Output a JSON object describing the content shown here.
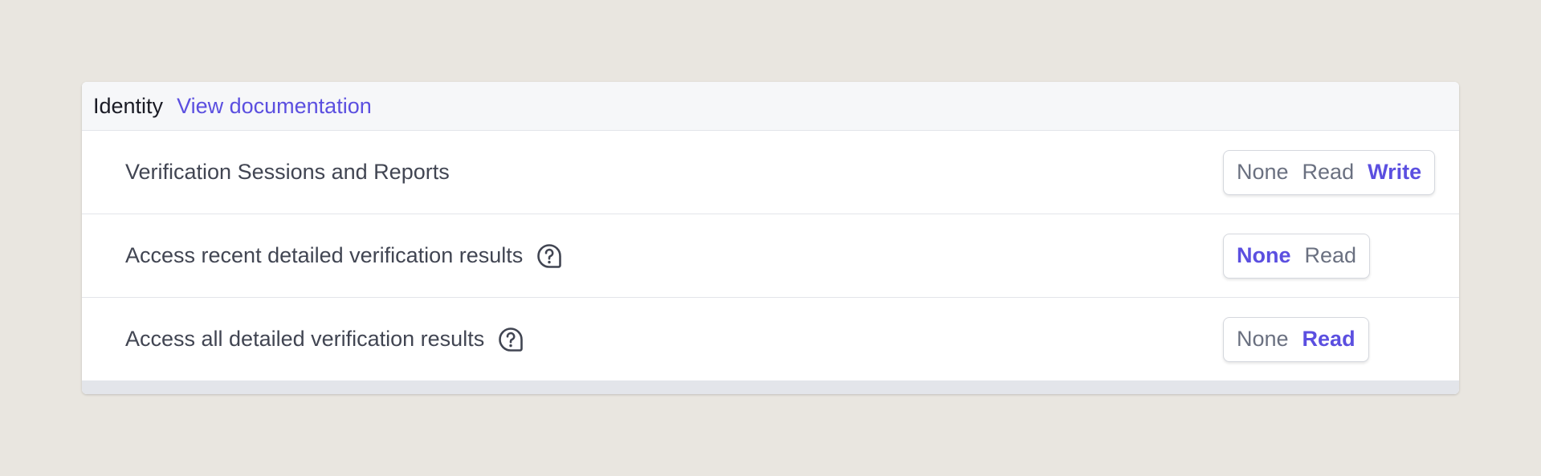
{
  "section": {
    "title": "Identity",
    "doc_link": "View documentation"
  },
  "rows": [
    {
      "label": "Verification Sessions and Reports",
      "has_help": false,
      "options": [
        "None",
        "Read",
        "Write"
      ],
      "selected": "Write"
    },
    {
      "label": "Access recent detailed verification results",
      "has_help": true,
      "options": [
        "None",
        "Read"
      ],
      "selected": "None"
    },
    {
      "label": "Access all detailed verification results",
      "has_help": true,
      "options": [
        "None",
        "Read"
      ],
      "selected": "Read"
    }
  ],
  "colors": {
    "accent": "#5b4fe0",
    "background": "#e9e6e0",
    "text": "#414552",
    "muted": "#6a7080"
  },
  "icons": {
    "help": "question-bubble-icon"
  }
}
